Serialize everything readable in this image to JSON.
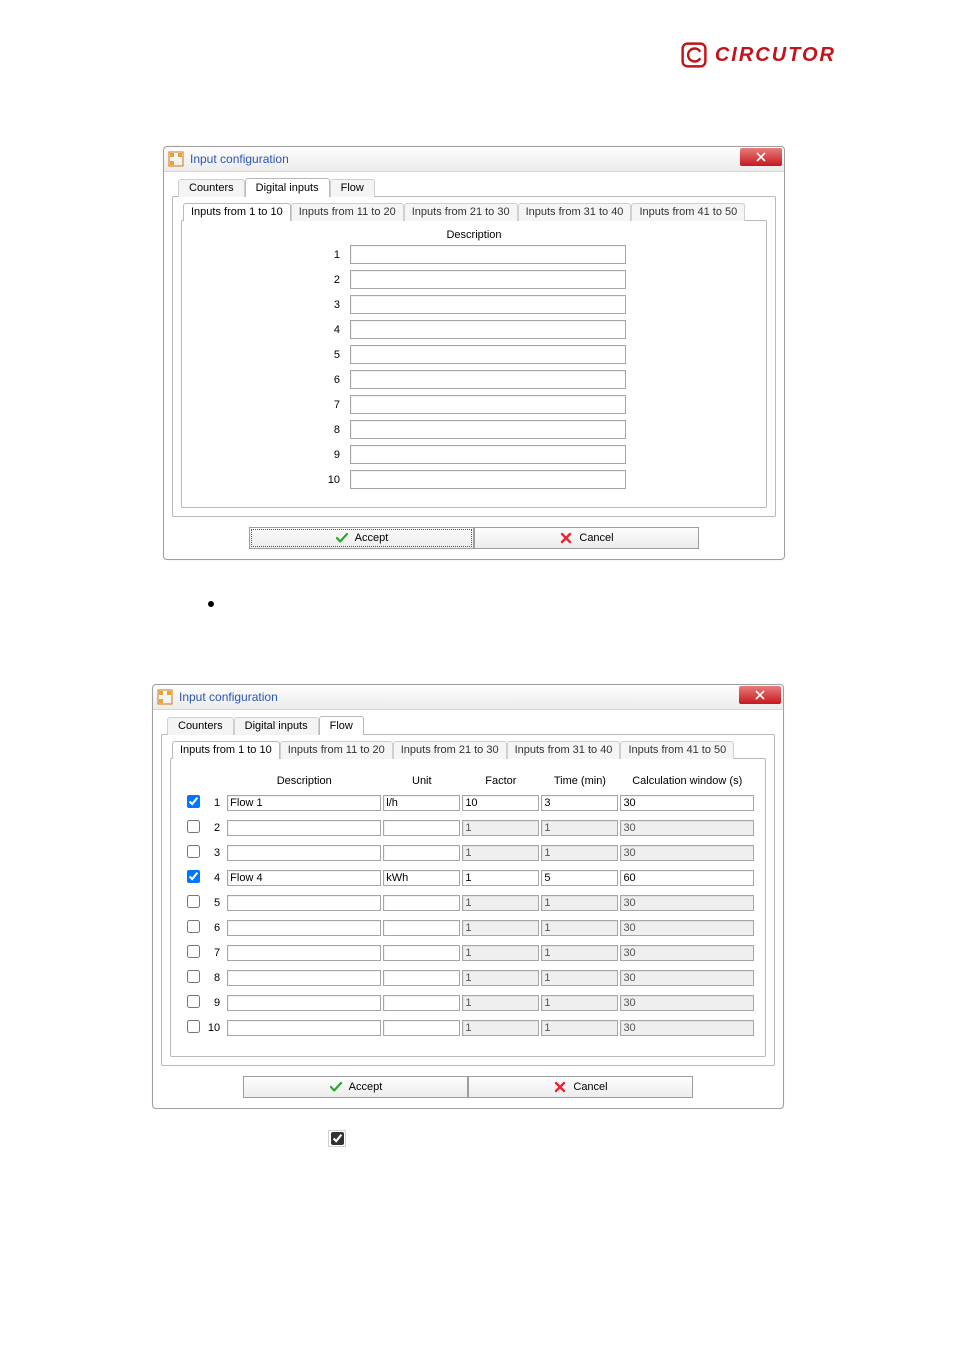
{
  "brand": {
    "name": "CIRCUTOR"
  },
  "dialog1": {
    "title": "Input configuration",
    "outerTabs": [
      "Counters",
      "Digital inputs",
      "Flow"
    ],
    "outerActive": 1,
    "rangeTabs": [
      "Inputs from 1 to 10",
      "Inputs from 11 to 20",
      "Inputs from 21 to 30",
      "Inputs from 31 to 40",
      "Inputs from 41 to 50"
    ],
    "rangeActive": 0,
    "columnHeader": "Description",
    "rows": [
      {
        "n": "1",
        "value": ""
      },
      {
        "n": "2",
        "value": ""
      },
      {
        "n": "3",
        "value": ""
      },
      {
        "n": "4",
        "value": ""
      },
      {
        "n": "5",
        "value": ""
      },
      {
        "n": "6",
        "value": ""
      },
      {
        "n": "7",
        "value": ""
      },
      {
        "n": "8",
        "value": ""
      },
      {
        "n": "9",
        "value": ""
      },
      {
        "n": "10",
        "value": ""
      }
    ],
    "acceptLabel": "Accept",
    "cancelLabel": "Cancel"
  },
  "dialog2": {
    "title": "Input configuration",
    "outerTabs": [
      "Counters",
      "Digital inputs",
      "Flow"
    ],
    "outerActive": 2,
    "rangeTabs": [
      "Inputs from 1 to 10",
      "Inputs from 11 to 20",
      "Inputs from 21 to 30",
      "Inputs from 31 to 40",
      "Inputs from 41 to 50"
    ],
    "rangeActive": 0,
    "headers": {
      "description": "Description",
      "unit": "Unit",
      "factor": "Factor",
      "time": "Time (min)",
      "calc": "Calculation window (s)"
    },
    "rows": [
      {
        "n": "1",
        "enabled": true,
        "description": "Flow 1",
        "unit": "l/h",
        "factor": "10",
        "time": "3",
        "calc": "30"
      },
      {
        "n": "2",
        "enabled": false,
        "description": "",
        "unit": "",
        "factor": "1",
        "time": "1",
        "calc": "30"
      },
      {
        "n": "3",
        "enabled": false,
        "description": "",
        "unit": "",
        "factor": "1",
        "time": "1",
        "calc": "30"
      },
      {
        "n": "4",
        "enabled": true,
        "description": "Flow 4",
        "unit": "kWh",
        "factor": "1",
        "time": "5",
        "calc": "60"
      },
      {
        "n": "5",
        "enabled": false,
        "description": "",
        "unit": "",
        "factor": "1",
        "time": "1",
        "calc": "30"
      },
      {
        "n": "6",
        "enabled": false,
        "description": "",
        "unit": "",
        "factor": "1",
        "time": "1",
        "calc": "30"
      },
      {
        "n": "7",
        "enabled": false,
        "description": "",
        "unit": "",
        "factor": "1",
        "time": "1",
        "calc": "30"
      },
      {
        "n": "8",
        "enabled": false,
        "description": "",
        "unit": "",
        "factor": "1",
        "time": "1",
        "calc": "30"
      },
      {
        "n": "9",
        "enabled": false,
        "description": "",
        "unit": "",
        "factor": "1",
        "time": "1",
        "calc": "30"
      },
      {
        "n": "10",
        "enabled": false,
        "description": "",
        "unit": "",
        "factor": "1",
        "time": "1",
        "calc": "30"
      }
    ],
    "acceptLabel": "Accept",
    "cancelLabel": "Cancel"
  },
  "loneCheckbox": {
    "checked": true
  }
}
